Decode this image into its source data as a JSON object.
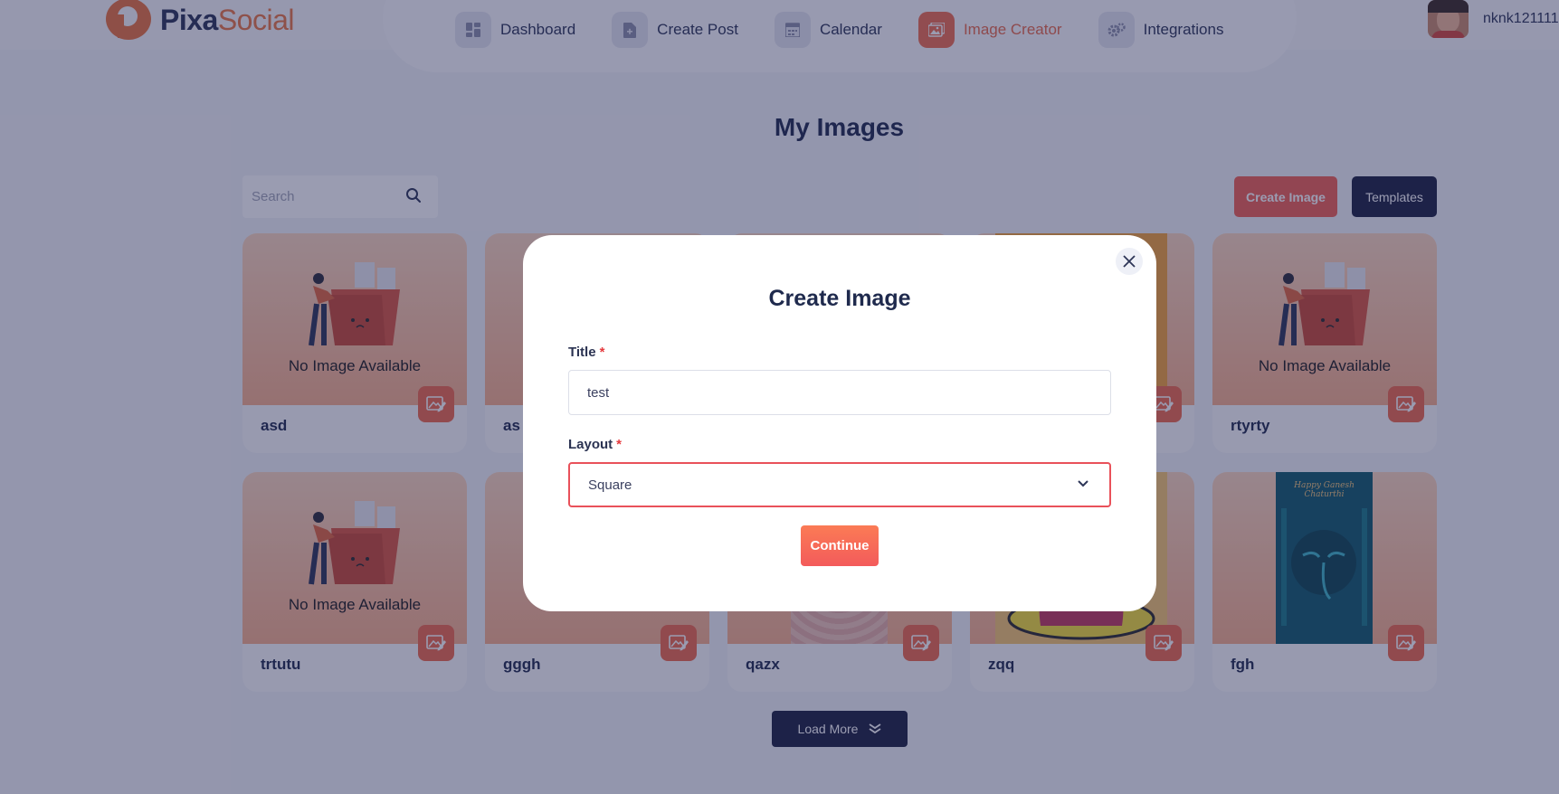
{
  "brand": {
    "name_part1": "Pixa",
    "name_part2": "Social"
  },
  "nav": [
    {
      "label": "Dashboard",
      "icon": "dashboard-icon"
    },
    {
      "label": "Create Post",
      "icon": "document-icon"
    },
    {
      "label": "Calendar",
      "icon": "calendar-icon"
    },
    {
      "label": "Image Creator",
      "icon": "image-icon",
      "active": true
    },
    {
      "label": "Integrations",
      "icon": "gears-icon"
    }
  ],
  "user": {
    "name": "nknk121111"
  },
  "page": {
    "title": "My Images"
  },
  "search": {
    "placeholder": "Search"
  },
  "actions": {
    "create_image": "Create Image",
    "templates": "Templates"
  },
  "cards": [
    {
      "title": "asd",
      "placeholder_text": "No Image Available"
    },
    {
      "title": "as"
    },
    {
      "title": ""
    },
    {
      "title": ""
    },
    {
      "title": "rtyrty",
      "placeholder_text": "No Image Available"
    },
    {
      "title": "trtutu",
      "placeholder_text": "No Image Available"
    },
    {
      "title": "gggh"
    },
    {
      "title": "qazx"
    },
    {
      "title": "zqq"
    },
    {
      "title": "fgh",
      "thumb_caption": "Happy Ganesh Chaturthi"
    }
  ],
  "load_more": {
    "label": "Load More"
  },
  "modal": {
    "title": "Create Image",
    "title_field": {
      "label": "Title",
      "required_mark": "*",
      "value": "test"
    },
    "layout_field": {
      "label": "Layout",
      "required_mark": "*",
      "value": "Square"
    },
    "continue_label": "Continue"
  },
  "colors": {
    "accent": "#ee6a4c",
    "dark": "#1c2140",
    "heading": "#1f2a4d",
    "danger": "#e9515a"
  }
}
